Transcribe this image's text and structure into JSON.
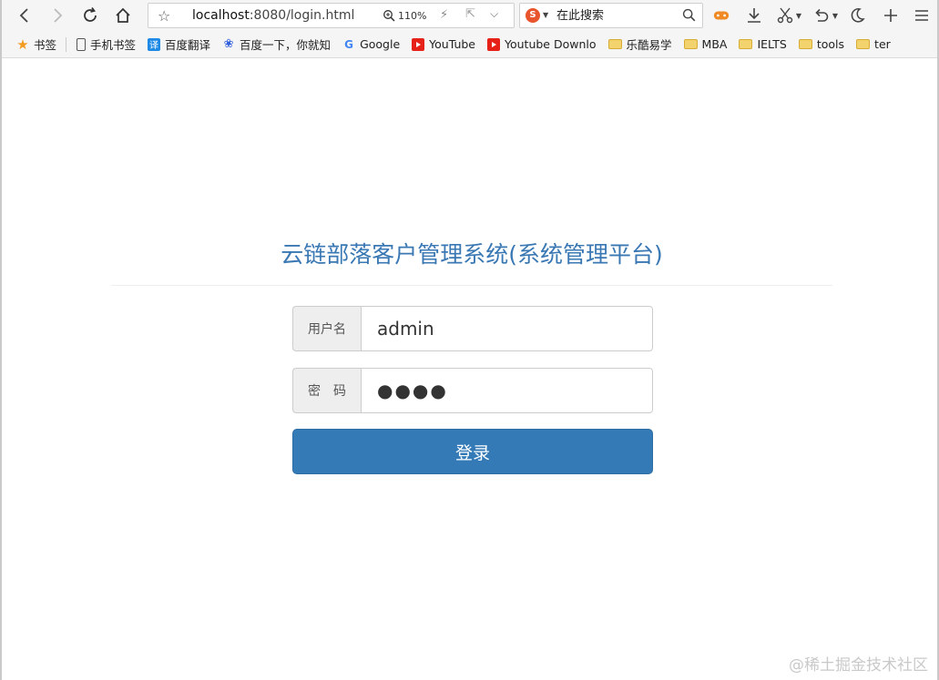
{
  "toolbar": {
    "url_host": "localhost",
    "url_rest": ":8080/login.html",
    "zoom": "110%",
    "search_placeholder": "在此搜索"
  },
  "bookmarks": [
    {
      "icon": "star-icon",
      "label": "书签"
    },
    {
      "icon": "phone-icon",
      "label": "手机书签"
    },
    {
      "icon": "translate-icon",
      "label": "百度翻译"
    },
    {
      "icon": "baidu-paw-icon",
      "label": "百度一下，你就知"
    },
    {
      "icon": "google-icon",
      "label": "Google"
    },
    {
      "icon": "youtube-icon",
      "label": "YouTube"
    },
    {
      "icon": "youtube-icon",
      "label": "Youtube Downlo"
    },
    {
      "icon": "folder-icon",
      "label": "乐酷易学"
    },
    {
      "icon": "folder-icon",
      "label": "MBA"
    },
    {
      "icon": "folder-icon",
      "label": "IELTS"
    },
    {
      "icon": "folder-icon",
      "label": "tools"
    },
    {
      "icon": "folder-icon",
      "label": "ter"
    }
  ],
  "login": {
    "title": "云链部落客户管理系统(系统管理平台)",
    "username_label": "用户名",
    "username_value": "admin",
    "password_label": "密　码",
    "password_value": "●●●●",
    "submit_label": "登录"
  },
  "watermark": "@稀土掘金技术社区",
  "colors": {
    "title": "#3a78b3",
    "button": "#337ab7"
  }
}
